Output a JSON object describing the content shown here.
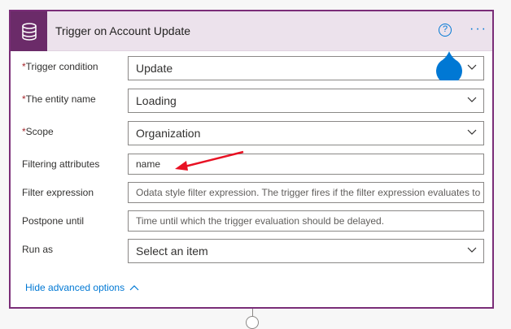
{
  "header": {
    "title": "Trigger on Account Update",
    "help_icon": "question-circle-icon",
    "more_icon": "ellipsis-icon",
    "help_label": "?",
    "more_label": "···",
    "accent_color": "#6b2b69",
    "link_color": "#0078d4"
  },
  "fields": [
    {
      "label": "Trigger condition",
      "required": "*",
      "value": "Update",
      "type": "dropdown"
    },
    {
      "label": "The entity name",
      "required": "*",
      "value": "Loading",
      "type": "dropdown"
    },
    {
      "label": "Scope",
      "required": "*",
      "value": "Organization",
      "type": "dropdown"
    },
    {
      "label": "Filtering attributes",
      "value": "name",
      "type": "text"
    },
    {
      "label": "Filter expression",
      "placeholder": "Odata style filter expression. The trigger fires if the filter expression evaluates to",
      "type": "text"
    },
    {
      "label": "Postpone until",
      "placeholder": "Time until which the trigger evaluation should be delayed.",
      "type": "text"
    },
    {
      "label": "Run as",
      "placeholder": "Select an item",
      "type": "dropdown"
    }
  ],
  "advanced": {
    "label": "Hide advanced options"
  }
}
